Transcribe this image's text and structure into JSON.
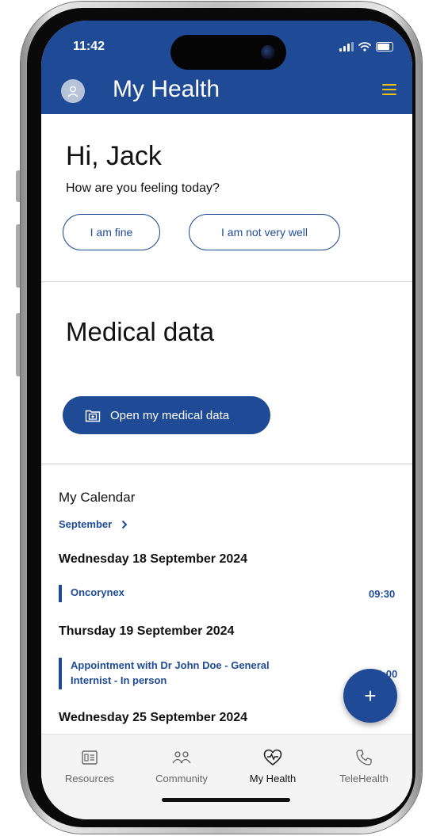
{
  "status_bar": {
    "time": "11:42"
  },
  "app_bar": {
    "title": "My Health"
  },
  "greeting": {
    "title": "Hi, Jack",
    "subtitle": "How are you feeling today?",
    "options": [
      "I am fine",
      "I am not very well"
    ]
  },
  "medical_data": {
    "title": "Medical data",
    "button_label": "Open my medical data"
  },
  "calendar": {
    "title": "My Calendar",
    "month": "September",
    "days": [
      {
        "date": "Wednesday 18 September 2024",
        "events": [
          {
            "name": "Oncorynex",
            "time": "09:30"
          }
        ]
      },
      {
        "date": "Thursday 19 September 2024",
        "events": [
          {
            "name": "Appointment with Dr John Doe - General Internist - In person",
            "time": "10:00"
          }
        ]
      },
      {
        "date": "Wednesday 25 September 2024"
      }
    ]
  },
  "fab": {
    "label": "+"
  },
  "bottom_nav": {
    "items": [
      {
        "label": "Resources",
        "icon": "resources-icon"
      },
      {
        "label": "Community",
        "icon": "community-icon"
      },
      {
        "label": "My Health",
        "icon": "heart-pulse-icon",
        "active": true
      },
      {
        "label": "TeleHealth",
        "icon": "phone-icon"
      }
    ]
  },
  "colors": {
    "primary": "#1f4b96",
    "menu_accent": "#f3c300",
    "nav_background": "#f4f4f4"
  }
}
